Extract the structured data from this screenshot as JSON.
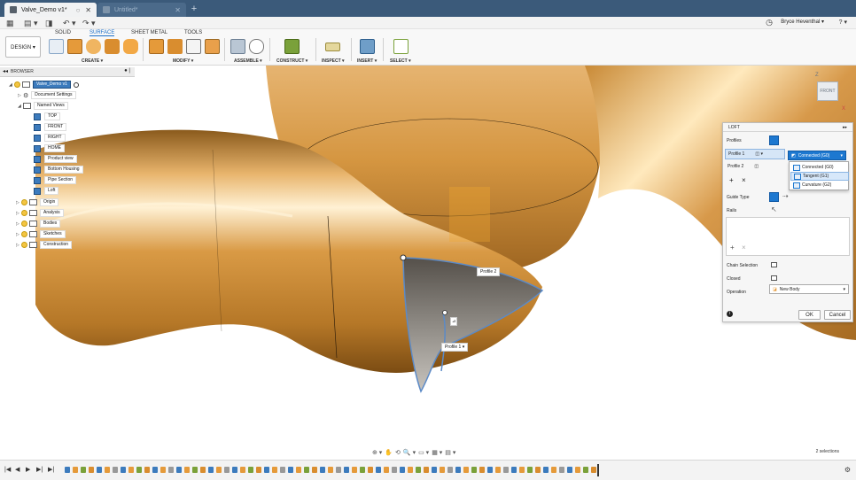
{
  "tabs": {
    "active": "Valve_Demo v1*",
    "inactive": "Untitled*",
    "add": "+"
  },
  "quick": {
    "grid": "▦",
    "file": "▤ ▾",
    "save": "◨",
    "undo": "↶ ▾",
    "redo": "↷ ▾",
    "user": "Bryce Heventhal ▾",
    "help": "? ▾",
    "clock": "◷"
  },
  "ribbon": {
    "design": "DESIGN ▾",
    "tabs": [
      "SOLID",
      "SURFACE",
      "SHEET METAL",
      "TOOLS"
    ],
    "groups": [
      "CREATE ▾",
      "MODIFY ▾",
      "ASSEMBLE ▾",
      "CONSTRUCT ▾",
      "INSPECT ▾",
      "INSERT ▾",
      "SELECT ▾"
    ]
  },
  "browser": {
    "title": "BROWSER",
    "root": "Valve_Demo v1",
    "doc_settings": "Document Settings",
    "named_views": "Named Views",
    "views": [
      "TOP",
      "FRONT",
      "RIGHT",
      "HOME",
      "Product view",
      "Bottom Housing",
      "Pipe Section",
      "Loft"
    ],
    "folders": [
      "Origin",
      "Analysis",
      "Bodies",
      "Sketches",
      "Construction"
    ]
  },
  "viewcube": {
    "face": "FRONT",
    "z": "Z",
    "x": "X"
  },
  "loft": {
    "title": "LOFT",
    "profiles": "Profiles",
    "profile1": "Profile 1",
    "profile2": "Profile 2",
    "selected_option": "Connected (G0)",
    "options": [
      "Connected (G0)",
      "Tangent (G1)",
      "Curvature (G2)"
    ],
    "guide_type": "Guide Type",
    "rails": "Rails",
    "add": "+",
    "remove": "×",
    "chain_selection": "Chain Selection",
    "closed": "Closed",
    "operation": "Operation",
    "operation_value": "New Body",
    "ok": "OK",
    "cancel": "Cancel",
    "info": "i"
  },
  "viewport_labels": {
    "profile2": "Profile 2",
    "profile1": "Profile 1 ▾"
  },
  "status": {
    "selections": "2 selections"
  },
  "navbar": [
    "⊕ ▾",
    "✋",
    "⟲",
    "🔍 ▾",
    "▭ ▾",
    "▦ ▾",
    "▤ ▾"
  ],
  "timeline": {
    "controls": [
      "|◀",
      "◀",
      "▶",
      "▶|",
      "▶|"
    ],
    "gear": "⚙"
  },
  "colors": {
    "tabbar": "#3b5a7a",
    "accent": "#1d78d0",
    "gold": "#d69a3c"
  }
}
